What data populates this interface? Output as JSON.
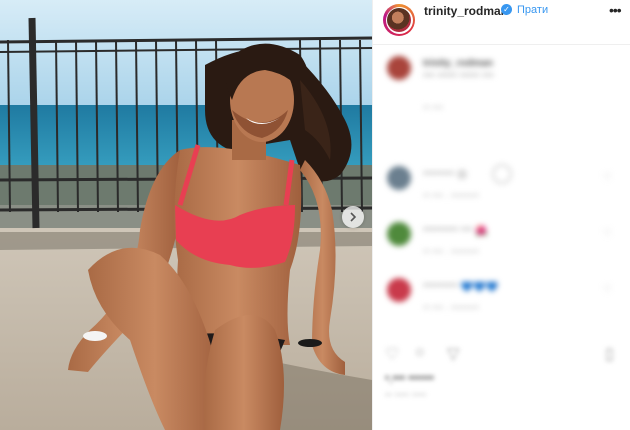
{
  "post": {
    "username": "trinity_rodman",
    "verified_mark": "✓",
    "follow_label": "Прати",
    "more_label": "•••"
  },
  "icons": {
    "more": "more-options-icon",
    "carousel_next": "chevron-right-icon",
    "verified": "verified-badge-icon"
  },
  "colors": {
    "link_blue": "#3897f0",
    "swimsuit_red": "#e83f52",
    "sea": "#2f8fb0",
    "sky": "#bcdff2"
  },
  "comments": [
    {
      "user": "trinity_rodman",
      "text": "*** ***** ***** ***",
      "meta": "** ***"
    },
    {
      "user": "******",
      "text": "******** 😍",
      "meta": "** *** · ********"
    },
    {
      "user": "*******",
      "text": "********* *** 🌺",
      "meta": "** *** · ********"
    },
    {
      "user": "******",
      "text": "********* 💙💙💙",
      "meta": "** *** · ********"
    }
  ],
  "footer": {
    "likes": "*.*** ****** ",
    "date": "** **** ****"
  }
}
